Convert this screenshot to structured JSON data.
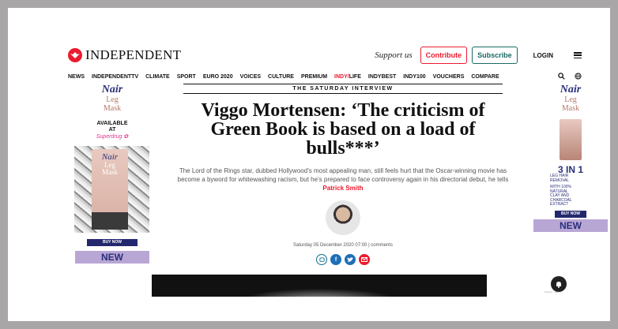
{
  "header": {
    "logo_text": "INDEPENDENT",
    "support_text": "Support us",
    "contribute_label": "Contribute",
    "subscribe_label": "Subscribe",
    "login_label": "LOGIN"
  },
  "nav": {
    "items": [
      "NEWS",
      "INDEPENDENTTV",
      "CLIMATE",
      "SPORT",
      "EURO 2020",
      "VOICES",
      "CULTURE",
      "PREMIUM"
    ],
    "indy_prefix": "INDY/",
    "indy_suffix": "LIFE",
    "items_after": [
      "INDYBEST",
      "INDY100",
      "VOUCHERS",
      "COMPARE"
    ]
  },
  "ad_left": {
    "brand": "Nair",
    "product_line1": "Leg",
    "product_line2": "Mask",
    "available_line1": "AVAILABLE",
    "available_line2": "AT",
    "retailer": "Superdrug ✿",
    "buy_now": "BUY NOW",
    "new_label": "NEW"
  },
  "ad_right": {
    "brand": "Nair",
    "product_line1": "Leg",
    "product_line2": "Mask",
    "three_in_one": "3 IN 1",
    "benefit_line1": "LEG HAIR",
    "benefit_line2": "REMOVAL",
    "ingredient_line1": "WITH 100%",
    "ingredient_line2": "NATURAL",
    "ingredient_line3": "CLAY AND",
    "ingredient_line4": "CHARCOAL",
    "ingredient_line5": "EXTRACT",
    "buy_now": "BUY NOW",
    "new_label": "NEW"
  },
  "article": {
    "kicker": "THE SATURDAY INTERVIEW",
    "headline": "Viggo Mortensen: ‘The criticism of Green Book is based on a load of bulls***’",
    "standfirst": "The Lord of the Rings star, dubbed Hollywood’s most appealing man, still feels hurt that the Oscar-winning movie has become a byword for whitewashing racism, but he’s prepared to face controversy again in his directorial debut, he tells ",
    "author": "Patrick Smith",
    "dateline": "Saturday 05 December 2020 07:00 |",
    "comments_label": "comments"
  },
  "misc": {
    "privacy_text": "Privacy - Terms"
  }
}
